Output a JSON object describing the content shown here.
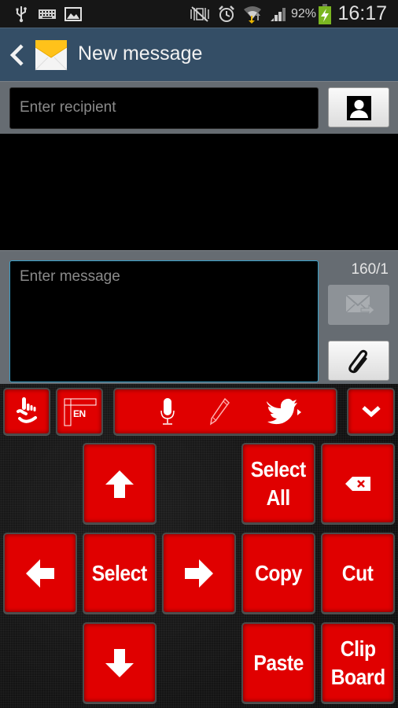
{
  "status_bar": {
    "left_icons": [
      "usb-icon",
      "keyboard-icon",
      "gallery-icon"
    ],
    "right_icons": [
      "mute-vibrate-icon",
      "alarm-icon",
      "wifi-icon",
      "signal-icon"
    ],
    "battery_percent": "92%",
    "battery_charging": true,
    "time": "16:17"
  },
  "title_bar": {
    "back_icon": "chevron-left-icon",
    "app_icon": "envelope-icon",
    "title": "New message"
  },
  "recipient": {
    "placeholder": "Enter recipient",
    "value": "",
    "contact_button_icon": "contact-icon"
  },
  "compose": {
    "placeholder": "Enter message",
    "value": "",
    "char_counter": "160/1",
    "send_button_icon": "send-message-icon",
    "send_enabled": false,
    "attach_button_icon": "paperclip-icon"
  },
  "keyboard": {
    "accent_color": "#e00000",
    "toolbar": [
      {
        "name": "gesture-key",
        "icon": "hand-gesture-icon"
      },
      {
        "name": "language-key",
        "icon": "language-icon",
        "label": "EN"
      },
      {
        "name": "voice-input-key",
        "icon": "microphone-icon"
      },
      {
        "name": "handwriting-key",
        "icon": "pencil-icon"
      },
      {
        "name": "twitter-key",
        "icon": "twitter-icon"
      },
      {
        "name": "hide-keyboard-key",
        "icon": "chevron-down-icon"
      }
    ],
    "keys": {
      "up": {
        "icon": "arrow-up-icon"
      },
      "select_all": {
        "label": "Select All",
        "line1": "Select",
        "line2": "All"
      },
      "backspace": {
        "icon": "backspace-icon"
      },
      "left": {
        "icon": "arrow-left-icon"
      },
      "select": {
        "label": "Select"
      },
      "right": {
        "icon": "arrow-right-icon"
      },
      "copy": {
        "label": "Copy"
      },
      "cut": {
        "label": "Cut"
      },
      "down": {
        "icon": "arrow-down-icon"
      },
      "paste": {
        "label": "Paste"
      },
      "clipboard": {
        "label": "Clip Board",
        "line1": "Clip",
        "line2": "Board"
      }
    }
  }
}
